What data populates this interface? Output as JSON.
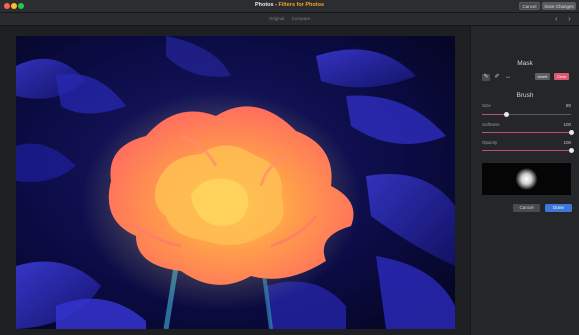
{
  "window": {
    "app_name": "Photos",
    "separator": "-",
    "extension_name": "Filters for Photos",
    "cancel_label": "Cancel",
    "save_label": "Save Changes"
  },
  "toolbar": {
    "tabs": [
      "Original",
      "Compare"
    ],
    "prev_icon": "chevron-left-icon",
    "next_icon": "chevron-right-icon"
  },
  "mask": {
    "title": "Mask",
    "tools": [
      "brush-icon",
      "eraser-icon",
      "visibility-icon"
    ],
    "active_tool": "brush-icon",
    "invert_label": "Invert",
    "clear_label": "Clear"
  },
  "brush": {
    "title": "Brush",
    "size": {
      "label": "Size",
      "value": "80",
      "fraction": 0.28
    },
    "softness": {
      "label": "Softness",
      "value": "100",
      "fraction": 1.0
    },
    "opacity": {
      "label": "Opacity",
      "value": "100",
      "fraction": 1.0
    }
  },
  "footer": {
    "cancel_label": "Cancel",
    "done_label": "Done"
  },
  "colors": {
    "accent": "#f5a623",
    "clear": "#e0566e",
    "done": "#3f77d6",
    "slider_fill": "#c0506a"
  }
}
